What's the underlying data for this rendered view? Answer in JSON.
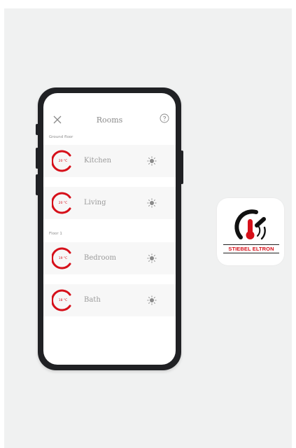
{
  "screen": {
    "title": "Rooms",
    "close_icon": "close-icon",
    "help_icon": "help-icon"
  },
  "sections": [
    {
      "label": "Ground floor",
      "rooms": [
        {
          "name": "Kitchen",
          "temp": "20 °C",
          "mode_icon": "sun-icon"
        },
        {
          "name": "Living",
          "temp": "20 °C",
          "mode_icon": "sun-icon"
        }
      ]
    },
    {
      "label": "Floor 1",
      "rooms": [
        {
          "name": "Bedroom",
          "temp": "19 °C",
          "mode_icon": "sun-icon"
        },
        {
          "name": "Bath",
          "temp": "18 °C",
          "mode_icon": "sun-icon"
        }
      ]
    }
  ],
  "app_icon": {
    "brand": "STIEBEL ELTRON",
    "icon": "thermometer-gauge-logo"
  },
  "colors": {
    "accent": "#d6101a",
    "background": "#f0f1f1",
    "phone_frame": "#202124",
    "room_row": "#f7f7f7"
  }
}
